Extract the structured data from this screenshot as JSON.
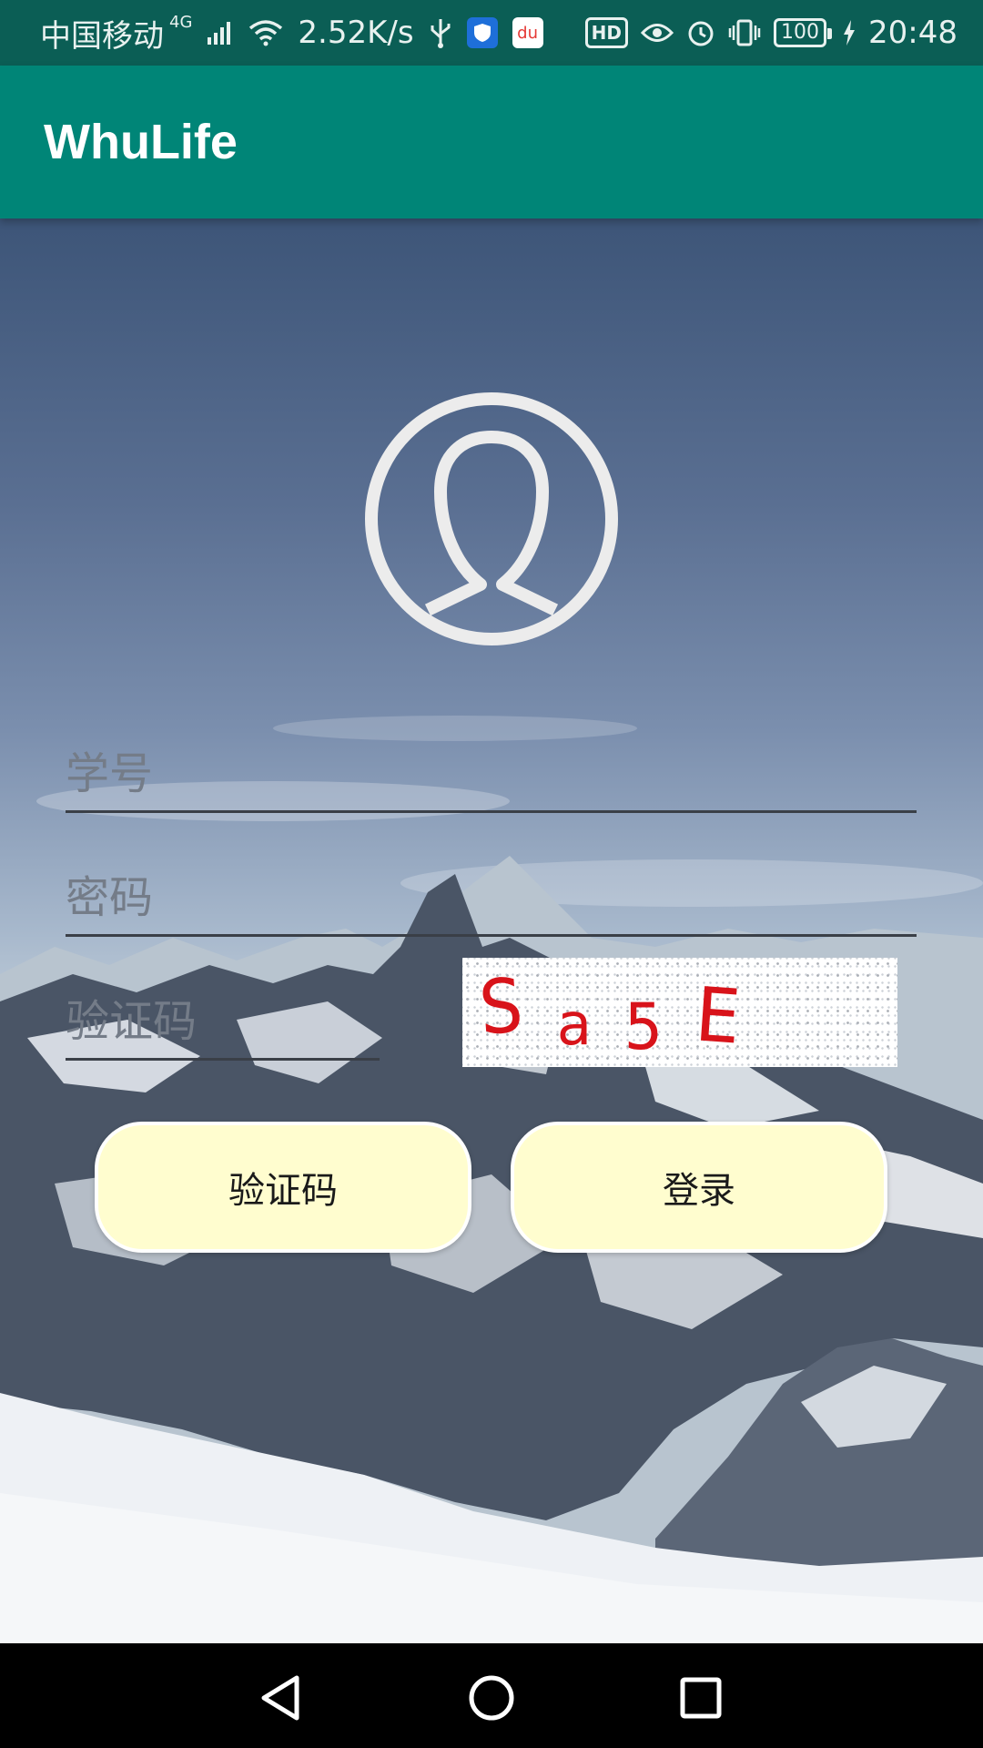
{
  "status_bar": {
    "carrier": "中国移动",
    "network_type": "4G",
    "speed": "2.52K/s",
    "hd": "HD",
    "battery": "100",
    "time": "20:48",
    "map_badge": "du"
  },
  "app_bar": {
    "title": "WhuLife"
  },
  "login_form": {
    "student_id_placeholder": "学号",
    "password_placeholder": "密码",
    "captcha_placeholder": "验证码",
    "captcha_image_text": [
      "S",
      "a",
      "5",
      "E"
    ],
    "get_captcha_button": "验证码",
    "login_button": "登录"
  },
  "colors": {
    "app_bar": "#008577",
    "status_bar": "#0b5e55",
    "button_fill": "#fffdcf",
    "captcha_text": "#d8131a"
  },
  "icons": {
    "avatar": "user-circle-icon",
    "nav_back": "back-triangle-icon",
    "nav_home": "home-circle-icon",
    "nav_recent": "recent-square-icon"
  }
}
